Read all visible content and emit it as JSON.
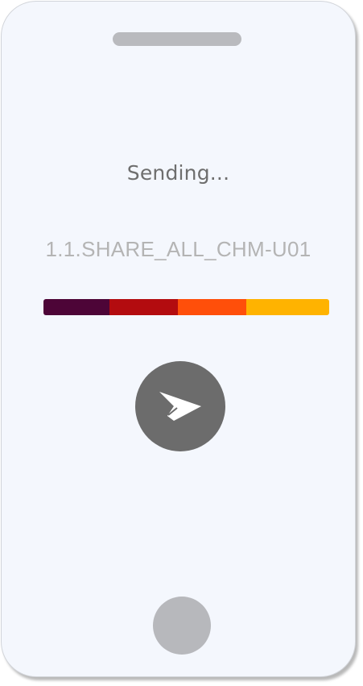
{
  "screen": {
    "status_text": "Sending...",
    "file_name": "1.1.SHARE_ALL_CHM-U01"
  },
  "progress": {
    "segments": [
      {
        "name": "segment-1",
        "color": "#4d0537",
        "fraction": 0.23
      },
      {
        "name": "segment-2",
        "color": "#b30c0f",
        "fraction": 0.24
      },
      {
        "name": "segment-3",
        "color": "#ff4f0a",
        "fraction": 0.24
      },
      {
        "name": "segment-4",
        "color": "#ffb300",
        "fraction": 0.29
      }
    ]
  },
  "send_button": {
    "icon": "paper-plane-icon",
    "color": "#6c6c6c"
  },
  "home_button": {
    "color": "#b7b8bc"
  }
}
